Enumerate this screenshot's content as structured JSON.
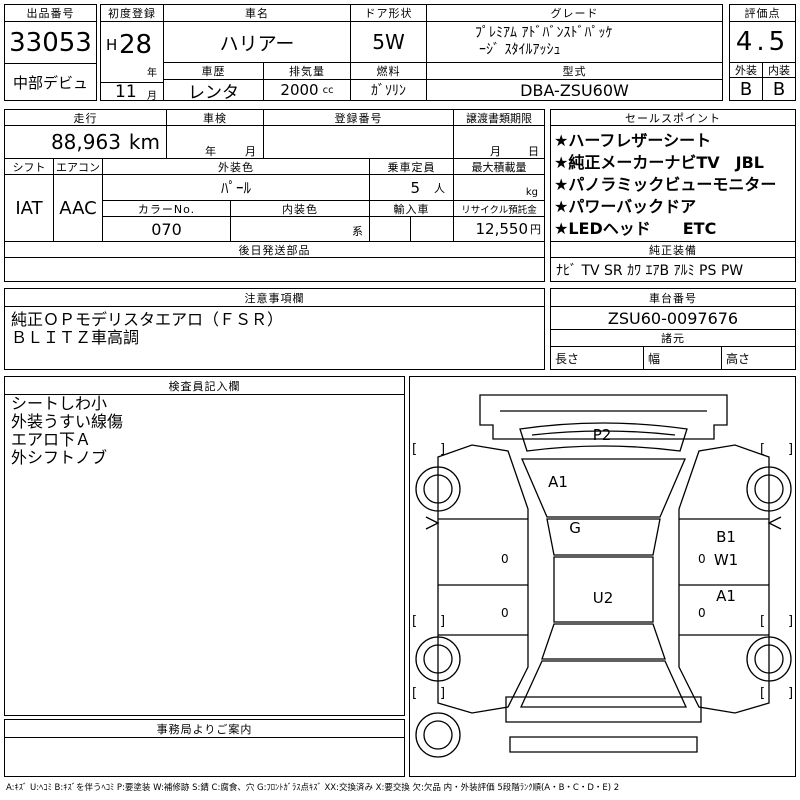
{
  "header": {
    "lot_no_label": "出品番号",
    "lot_no": "33053",
    "tag": "中部デビュ",
    "first_reg_label": "初度登録",
    "era": "H",
    "year": "28",
    "year_unit": "年",
    "month": "11",
    "month_unit": "月",
    "car_name_label": "車名",
    "car_name": "ハリアー",
    "door_label": "ドア形状",
    "door": "5W",
    "grade_label": "グレード",
    "grade_line1": "ﾌﾟﾚﾐｱﾑ ｱﾄﾞﾊﾞﾝｽﾄﾞﾊﾟｯｹ",
    "grade_line2": "ｰｼﾞ ｽﾀｲﾙｱｯｼｭ",
    "history_label": "車歴",
    "history": "レンタ",
    "displacement_label": "排気量",
    "displacement": "2000",
    "displacement_unit": "cc",
    "fuel_label": "燃料",
    "fuel": "ｶﾞｿﾘﾝ",
    "model_label": "型式",
    "model": "DBA-ZSU60W",
    "score_label": "評価点",
    "score": "4.5",
    "ext_label": "外装",
    "ext": "B",
    "int_label": "内装",
    "int": "B"
  },
  "row2": {
    "mileage_label": "走行",
    "mileage": "88,963",
    "mileage_unit": "km",
    "inspection_label": "車検",
    "inspection_year_unit": "年",
    "inspection_month_unit": "月",
    "reg_no_label": "登録番号",
    "transfer_label": "譲渡書類期限",
    "transfer_month_unit": "月",
    "transfer_day_unit": "日",
    "shift_label": "シフト",
    "shift": "IAT",
    "ac_label": "エアコン",
    "ac": "AAC",
    "ext_color_label": "外装色",
    "ext_color": "ﾊﾟｰﾙ",
    "capacity_label": "乗車定員",
    "capacity": "5",
    "capacity_unit": "人",
    "max_load_label": "最大積載量",
    "max_load_unit": "kg",
    "color_no_label": "カラーNo.",
    "color_no": "070",
    "int_color_label": "内装色",
    "int_color_unit": "系",
    "import_label": "輸入車",
    "recycle_label": "リサイクル預託金",
    "recycle": "12,550",
    "recycle_unit": "円",
    "later_parts_label": "後日発送部品"
  },
  "sales_points": {
    "label": "セールスポイント",
    "items": [
      "★ハーフレザーシート",
      "★純正メーカーナビTV　JBL",
      "★パノラミックビューモニター",
      "★パワーバックドア",
      "★LEDヘッド　　ETC"
    ]
  },
  "equipment": {
    "label": "純正装備",
    "value": "ﾅﾋﾞ TV SR ｶﾜ ｴｱB ｱﾙﾐ PS PW"
  },
  "notes": {
    "label": "注意事項欄",
    "lines": [
      "純正ＯＰモデリスタエアロ（ＦＳＲ）",
      "ＢＬＩＴＺ車高調"
    ]
  },
  "chassis": {
    "label": "車台番号",
    "value": "ZSU60-0097676",
    "dims_label": "諸元",
    "length_label": "長さ",
    "width_label": "幅",
    "height_label": "高さ"
  },
  "inspector": {
    "label": "検査員記入欄",
    "lines": [
      "シートしわ小",
      "外装うすい線傷",
      "エアロ下Ａ",
      "外シフトノブ"
    ]
  },
  "office": {
    "label": "事務局よりご案内"
  },
  "diagram": {
    "marks": [
      "P2",
      "A1",
      "G",
      "U2",
      "B1",
      "W1",
      "A1"
    ],
    "brackets": [
      "[",
      "]",
      "[",
      "]",
      "[",
      "]",
      "[",
      "]",
      "[",
      "]",
      "[",
      "]"
    ],
    "zeros": [
      "0",
      "0",
      "0",
      "0"
    ]
  },
  "legend": "A:ｷｽﾞ U:ﾍｺﾐ B:ｷｽﾞを伴うﾍｺﾐ P:要塗装 W:補修跡 S:錆 C:腐食、穴 G:ﾌﾛﾝﾄｶﾞﾗｽ点ｷｽﾞ XX:交換済み X:要交換 欠:欠品 内・外装評価 5段階ﾗﾝｸ順(A・B・C・D・E) 2"
}
